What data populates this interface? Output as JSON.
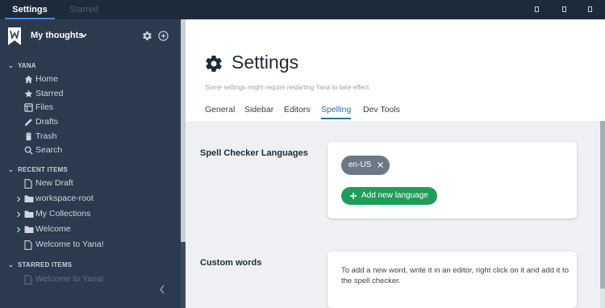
{
  "top_tabs": [
    {
      "label": "Settings",
      "active": true
    },
    {
      "label": "Starred",
      "active": false
    }
  ],
  "sidebar": {
    "workspace_title": "My thoughts",
    "sections": {
      "yana": "YANA",
      "recent": "RECENT ITEMS",
      "starred": "STARRED ITEMS"
    },
    "nav_items": [
      {
        "label": "Home",
        "icon": "home-icon"
      },
      {
        "label": "Starred",
        "icon": "star-icon"
      },
      {
        "label": "Files",
        "icon": "files-icon"
      },
      {
        "label": "Drafts",
        "icon": "pencil-icon"
      },
      {
        "label": "Trash",
        "icon": "trash-icon"
      },
      {
        "label": "Search",
        "icon": "search-icon"
      }
    ],
    "recent_items": [
      {
        "label": "New Draft",
        "type": "document"
      },
      {
        "label": "workspace-root",
        "type": "folder"
      },
      {
        "label": "My Collections",
        "type": "folder"
      },
      {
        "label": "Welcome",
        "type": "folder"
      },
      {
        "label": "Welcome to Yana!",
        "type": "document"
      }
    ],
    "starred_items": [
      {
        "label": "Welcome to Yana!",
        "type": "document"
      }
    ]
  },
  "page": {
    "title": "Settings",
    "subtitle": "Some settings might require restarting Yana to take effect.",
    "tabs": [
      {
        "label": "General",
        "active": false
      },
      {
        "label": "Sidebar",
        "active": false
      },
      {
        "label": "Editors",
        "active": false
      },
      {
        "label": "Spelling",
        "active": true
      },
      {
        "label": "Dev Tools",
        "active": false
      }
    ]
  },
  "spell_checker": {
    "label": "Spell Checker Languages",
    "languages": [
      "en-US"
    ],
    "add_button": "Add new language"
  },
  "custom_words": {
    "label": "Custom words",
    "info": "To add a new word, write it in an editor, right click on it and add it to the spell checker."
  },
  "colors": {
    "sidebar_bg": "#2b3a4d",
    "accent": "#2f6fae",
    "add_button": "#1e9e5a",
    "chip": "#6b7886"
  }
}
